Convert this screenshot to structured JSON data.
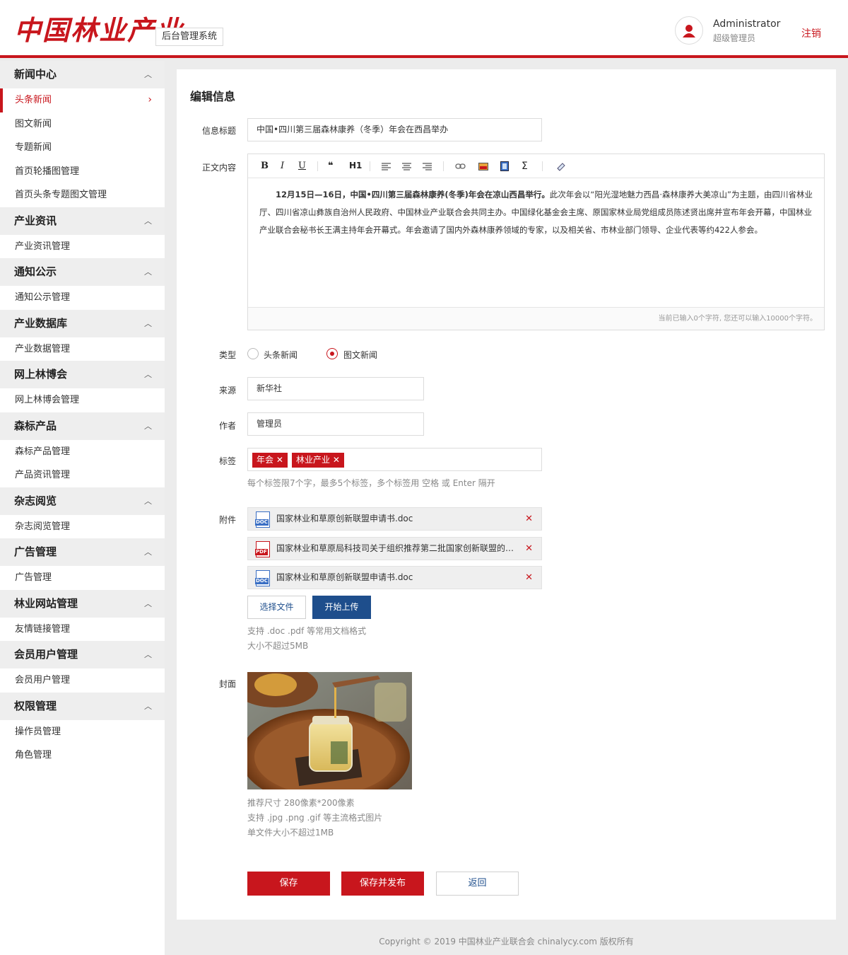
{
  "header": {
    "logo_text": "中国林业产业",
    "system_name": "后台管理系统",
    "user_name": "Administrator",
    "user_role": "超级管理员",
    "logout_label": "注销"
  },
  "sidebar": {
    "groups": [
      {
        "title": "新闻中心",
        "items": [
          "头条新闻",
          "图文新闻",
          "专题新闻",
          "首页轮播图管理",
          "首页头条专题图文管理"
        ]
      },
      {
        "title": "产业资讯",
        "items": [
          "产业资讯管理"
        ]
      },
      {
        "title": "通知公示",
        "items": [
          "通知公示管理"
        ]
      },
      {
        "title": "产业数据库",
        "items": [
          "产业数据管理"
        ]
      },
      {
        "title": "网上林博会",
        "items": [
          "网上林博会管理"
        ]
      },
      {
        "title": "森标产品",
        "items": [
          "森标产品管理",
          "产品资讯管理"
        ]
      },
      {
        "title": "杂志阅览",
        "items": [
          "杂志阅览管理"
        ]
      },
      {
        "title": "广告管理",
        "items": [
          "广告管理"
        ]
      },
      {
        "title": "林业网站管理",
        "items": [
          "友情链接管理"
        ]
      },
      {
        "title": "会员用户管理",
        "items": [
          "会员用户管理"
        ]
      },
      {
        "title": "权限管理",
        "items": [
          "操作员管理",
          "角色管理"
        ]
      }
    ],
    "active_item": "头条新闻"
  },
  "form": {
    "page_title": "编辑信息",
    "title_label": "信息标题",
    "title_value": "中国•四川第三届森林康养（冬季）年会在西昌举办",
    "content_label": "正文内容",
    "toolbar": {
      "bold": "B",
      "italic": "I",
      "underline": "U",
      "quote": "❝",
      "heading": "H1",
      "formula": "Σ"
    },
    "content_bold": "12月15日—16日，中国•四川第三届森林康养(冬季)年会在凉山西昌举行。",
    "content_rest": "此次年会以“阳光湿地魅力西昌·森林康养大美凉山”为主题，由四川省林业厅、四川省凉山彝族自治州人民政府、中国林业产业联合会共同主办。中国绿化基金会主席、原国家林业局党组成员陈述贤出席并宣布年会开幕，中国林业产业联合会秘书长王满主持年会开幕式。年会邀请了国内外森林康养领域的专家，以及相关省、市林业部门领导、企业代表等约422人参会。",
    "counter": "当前已输入0个字符, 您还可以输入10000个字符。",
    "type_label": "类型",
    "type_options": [
      "头条新闻",
      "图文新闻"
    ],
    "type_selected": "图文新闻",
    "source_label": "来源",
    "source_value": "新华社",
    "author_label": "作者",
    "author_value": "管理员",
    "tags_label": "标签",
    "tags": [
      "年会",
      "林业产业"
    ],
    "tags_hint": "每个标签限7个字，最多5个标签，多个标签用 空格 或 Enter 隔开",
    "attach_label": "附件",
    "attachments": [
      {
        "type": "DOC",
        "name": "国家林业和草原创新联盟申请书.doc"
      },
      {
        "type": "PDF",
        "name": "国家林业和草原局科技司关于组织推荐第二批国家创新联盟的通知.pdf"
      },
      {
        "type": "DOC",
        "name": "国家林业和草原创新联盟申请书.doc"
      }
    ],
    "choose_file": "选择文件",
    "start_upload": "开始上传",
    "attach_hint1": "支持 .doc .pdf 等常用文档格式",
    "attach_hint2": "大小不超过5MB",
    "cover_label": "封面",
    "cover_hint1": "推荐尺寸 280像素*200像素",
    "cover_hint2": "支持 .jpg .png .gif 等主流格式图片",
    "cover_hint3": "单文件大小不超过1MB",
    "save": "保存",
    "save_publish": "保存并发布",
    "back": "返回"
  },
  "footer": "Copyright © 2019 中国林业产业联合会 chinalycy.com 版权所有",
  "colors": {
    "accent": "#c8161d",
    "blue": "#1e4e8c"
  }
}
